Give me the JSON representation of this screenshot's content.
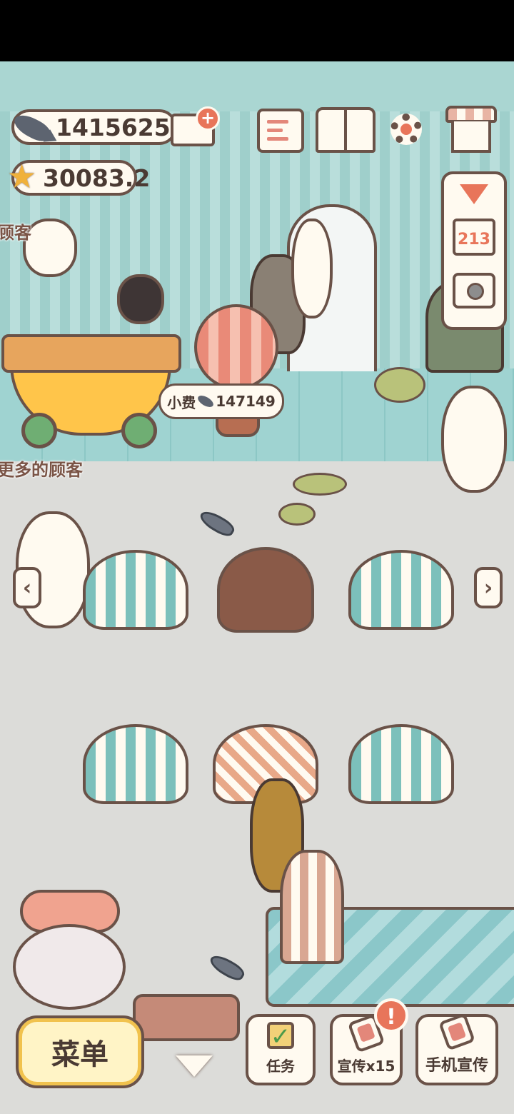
{
  "hud": {
    "fish_count": "1415625",
    "star_count": "30083.2"
  },
  "scene": {
    "tip_label": "小费",
    "tip_amount": "147149",
    "left_customer_label": "顾客",
    "more_customers_text": "更多的顾客"
  },
  "side_panel": {
    "ranking_label": "213"
  },
  "bottom_bar": {
    "menu_label": "菜单",
    "task_label": "任务",
    "promo_label": "宣传x15",
    "phone_promo_label": "手机宣传",
    "alert_mark": "!"
  },
  "colors": {
    "accent": "#e8755a",
    "outline": "#6a5248",
    "wall": "#9fcfcb",
    "menu_button": "#fff4c6"
  }
}
